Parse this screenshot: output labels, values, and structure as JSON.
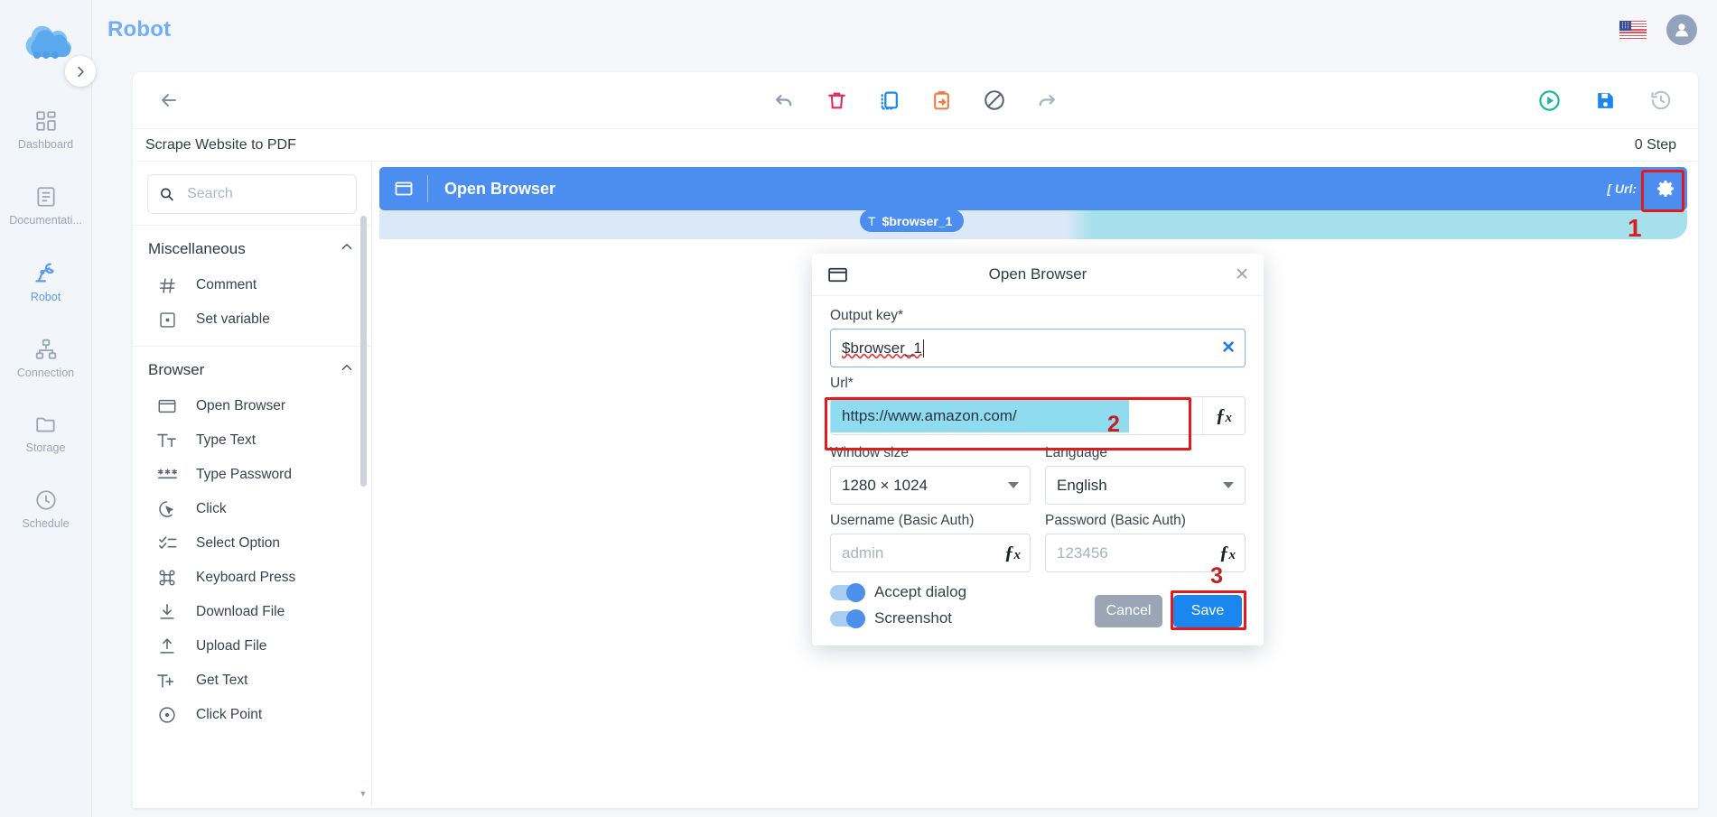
{
  "header": {
    "title": "Robot",
    "flag_icon": "us-flag-icon",
    "avatar_icon": "user-avatar-icon"
  },
  "rail": {
    "logo_icon": "cloud-logo-icon",
    "toggle_icon": "chevron-right-icon",
    "items": [
      {
        "label": "Dashboard",
        "icon": "grid-icon",
        "active": false
      },
      {
        "label": "Documentati...",
        "icon": "document-icon",
        "active": false
      },
      {
        "label": "Robot",
        "icon": "robot-arm-icon",
        "active": true
      },
      {
        "label": "Connection",
        "icon": "sitemap-icon",
        "active": false
      },
      {
        "label": "Storage",
        "icon": "folder-icon",
        "active": false
      },
      {
        "label": "Schedule",
        "icon": "clock-icon",
        "active": false
      }
    ]
  },
  "toolbar": {
    "back_icon": "arrow-left-icon",
    "center_buttons": [
      {
        "name": "undo-button",
        "icon": "undo-arrow-icon",
        "color": "#8e9bb0"
      },
      {
        "name": "delete-button",
        "icon": "trash-icon",
        "color": "#e8255f"
      },
      {
        "name": "copy-button",
        "icon": "copy-dashed-icon",
        "color": "#1a86f0"
      },
      {
        "name": "paste-button",
        "icon": "clipboard-icon",
        "color": "#f07a3c"
      },
      {
        "name": "disable-button",
        "icon": "ban-circle-icon",
        "color": "#5a6370"
      },
      {
        "name": "redo-button",
        "icon": "redo-arrow-icon",
        "color": "#aab3c0"
      }
    ],
    "right_buttons": [
      {
        "name": "run-button",
        "icon": "play-circle-icon",
        "color": "#12b89a"
      },
      {
        "name": "save-button",
        "icon": "floppy-disk-icon",
        "color": "#1a86f0"
      },
      {
        "name": "history-button",
        "icon": "history-icon",
        "color": "#b6bfcb"
      }
    ]
  },
  "subheader": {
    "workflow_name": "Scrape Website to PDF",
    "step_count": "0 Step"
  },
  "palette": {
    "search_placeholder": "Search",
    "search_value": "",
    "search_icon": "search-icon",
    "groups": [
      {
        "title": "Miscellaneous",
        "chevron": "chevron-up-icon",
        "items": [
          {
            "label": "Comment",
            "icon": "hash-icon"
          },
          {
            "label": "Set variable",
            "icon": "save-variable-icon"
          }
        ]
      },
      {
        "title": "Browser",
        "chevron": "chevron-up-icon",
        "items": [
          {
            "label": "Open Browser",
            "icon": "browser-window-icon"
          },
          {
            "label": "Type Text",
            "icon": "type-text-icon"
          },
          {
            "label": "Type Password",
            "icon": "asterisks-icon"
          },
          {
            "label": "Click",
            "icon": "click-cursor-icon"
          },
          {
            "label": "Select Option",
            "icon": "checklist-icon"
          },
          {
            "label": "Keyboard Press",
            "icon": "command-key-icon"
          },
          {
            "label": "Download File",
            "icon": "download-icon"
          },
          {
            "label": "Upload File",
            "icon": "upload-icon"
          },
          {
            "label": "Get Text",
            "icon": "get-text-icon"
          },
          {
            "label": "Click Point",
            "icon": "click-point-icon"
          }
        ]
      }
    ]
  },
  "canvas": {
    "step": {
      "title": "Open Browser",
      "icon": "browser-window-icon",
      "meta": "[ Url:",
      "gear_icon": "gear-icon",
      "variable_badge": "$browser_1",
      "variable_badge_glyph": "T"
    },
    "callouts": {
      "one": "1",
      "two": "2",
      "three": "3"
    }
  },
  "modal": {
    "title": "Open Browser",
    "title_icon": "browser-window-icon",
    "close_icon": "close-icon",
    "output_key": {
      "label": "Output key*",
      "value": "$browser_1",
      "clear_icon": "clear-x-icon"
    },
    "url": {
      "label": "Url*",
      "value": "https://www.amazon.com/",
      "fx_label": "fx",
      "fx_icon": "function-icon"
    },
    "window_size": {
      "label": "Window size",
      "value": "1280 × 1024",
      "caret_icon": "chevron-down-icon"
    },
    "language": {
      "label": "Language",
      "value": "English",
      "caret_icon": "chevron-down-icon"
    },
    "username": {
      "label": "Username (Basic Auth)",
      "placeholder": "admin",
      "value": "",
      "fx_label": "fx"
    },
    "password": {
      "label": "Password (Basic Auth)",
      "placeholder": "123456",
      "value": "",
      "fx_label": "fx"
    },
    "toggles": [
      {
        "label": "Accept dialog",
        "on": true
      },
      {
        "label": "Screenshot",
        "on": true
      }
    ],
    "buttons": {
      "cancel": "Cancel",
      "save": "Save"
    }
  },
  "colors": {
    "accent_blue": "#4b8ef0",
    "brand_blue": "#72aef6",
    "highlight_red": "#e01b1b",
    "selection_cyan": "#8fdcf0",
    "save_blue": "#1a86f0"
  }
}
